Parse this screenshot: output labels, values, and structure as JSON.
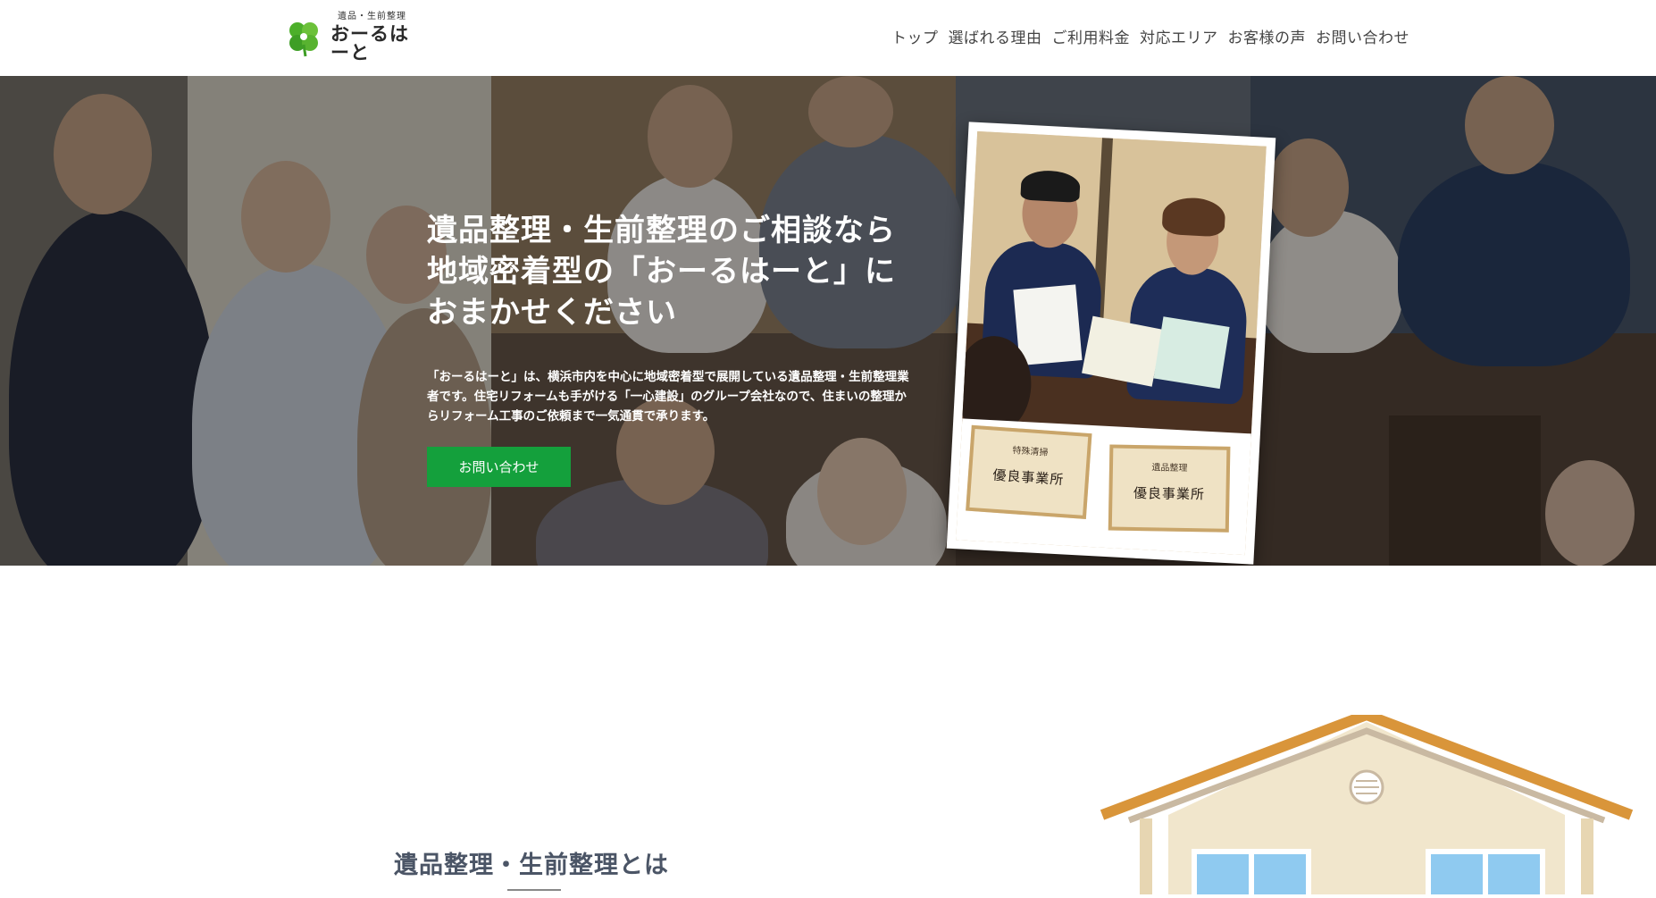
{
  "header": {
    "logo_sub": "遺品・生前整理",
    "logo_main": "おーるはーと",
    "nav": [
      "トップ",
      "選ばれる理由",
      "ご利用料金",
      "対応エリア",
      "お客様の声",
      "お問い合わせ"
    ]
  },
  "hero": {
    "title": "遺品整理・生前整理のご相談なら地域密着型の「おーるはーと」におまかせください",
    "description": "「おーるはーと」は、横浜市内を中心に地域密着型で展開している遺品整理・生前整理業者です。住宅リフォームも手がける「一心建設」のグループ会社なので、住まいの整理からリフォーム工事のご依頼まで一気通貫で承ります。",
    "cta_label": "お問い合わせ",
    "photo": {
      "certificate_left_heading": "特殊清掃",
      "certificate_left_title": "優良事業所",
      "certificate_right_heading": "遺品整理",
      "certificate_right_title": "優良事業所"
    }
  },
  "about": {
    "title": "遺品整理・生前整理とは"
  },
  "colors": {
    "brand_green": "#14a03c",
    "nav_text": "#444444",
    "about_title": "#4b5566",
    "roof": "#d9953a"
  }
}
